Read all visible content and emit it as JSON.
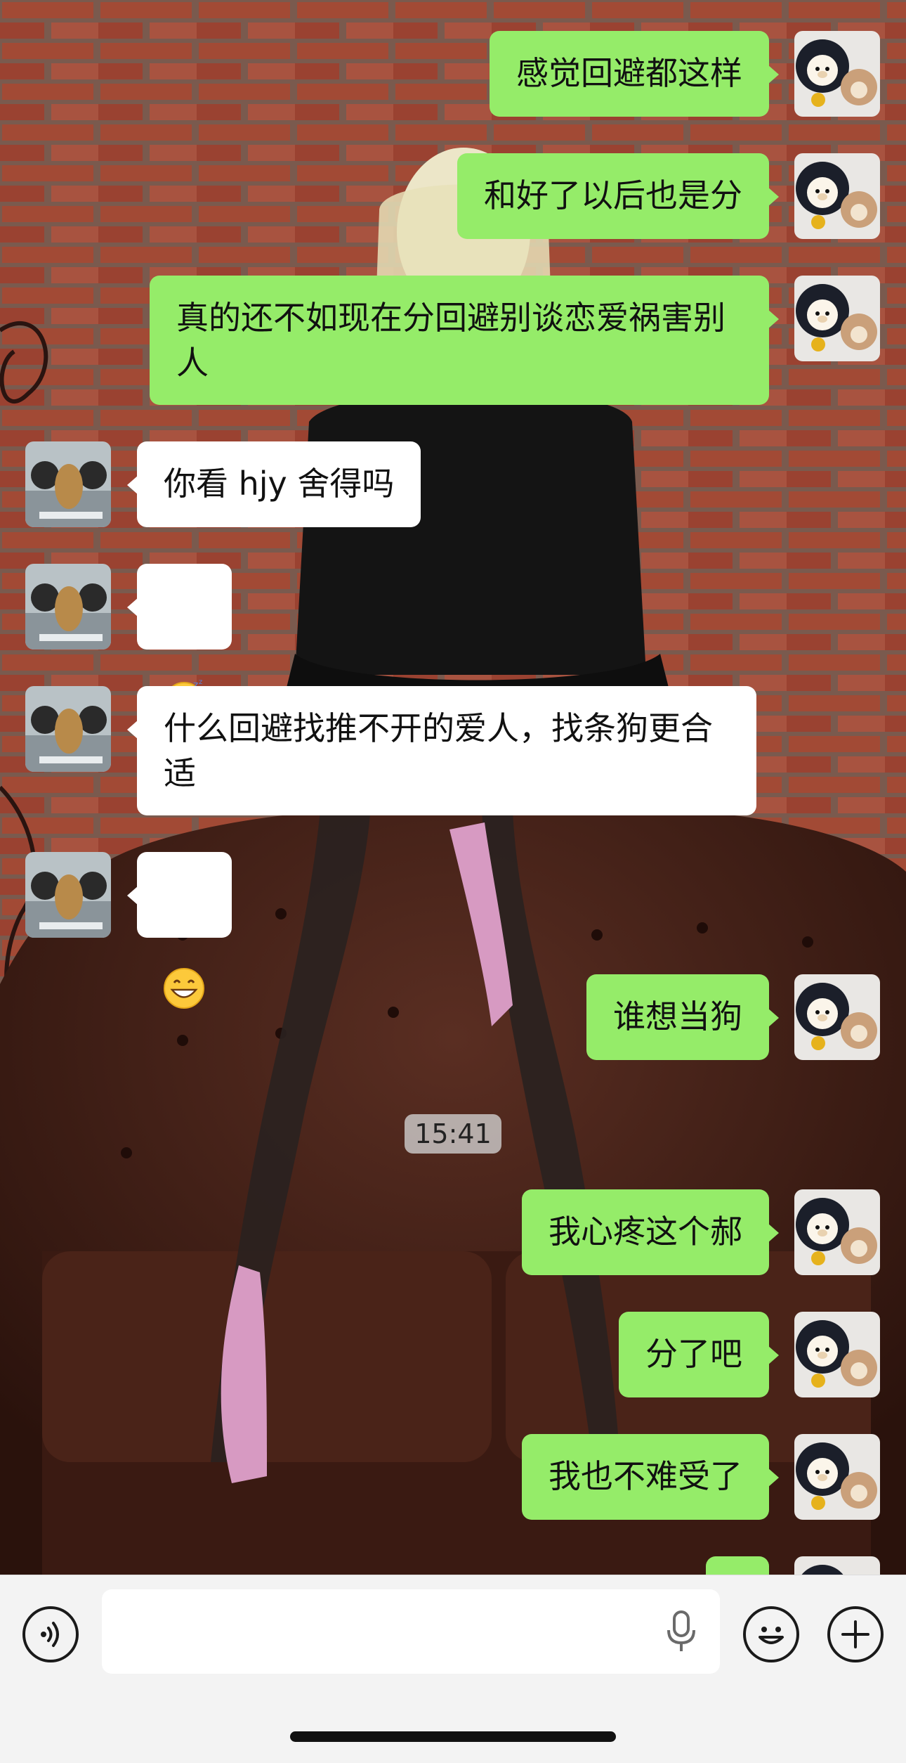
{
  "messages": [
    {
      "side": "me",
      "text": "感觉回避都这样"
    },
    {
      "side": "me",
      "text": "和好了以后也是分"
    },
    {
      "side": "me",
      "text": "真的还不如现在分回避别谈恋爱祸害别人"
    },
    {
      "side": "them",
      "text": "你看 hjy 舍得吗"
    },
    {
      "side": "them",
      "emoji": "sleeping-face-icon"
    },
    {
      "side": "them",
      "text": "什么回避找推不开的爱人，找条狗更合适"
    },
    {
      "side": "them",
      "emoji": "grinning-face-icon"
    },
    {
      "side": "me",
      "text": "谁想当狗"
    },
    {
      "side": "me",
      "text": "我心疼这个郝"
    },
    {
      "side": "me",
      "text": "分了吧"
    },
    {
      "side": "me",
      "text": "我也不难受了"
    }
  ],
  "timestamp": "15:41",
  "input": {
    "placeholder": ""
  },
  "colors": {
    "outgoing_bubble": "#95ec69",
    "incoming_bubble": "#ffffff",
    "input_bar": "#f3f3f3"
  },
  "icons": {
    "left": "voice-icon",
    "mic": "microphone-icon",
    "emoji": "emoji-icon",
    "plus": "plus-icon"
  }
}
